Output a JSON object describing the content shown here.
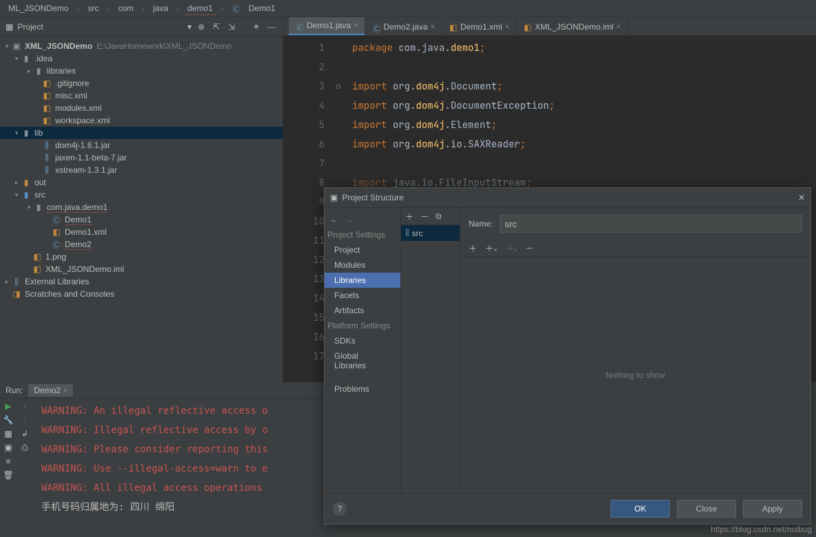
{
  "breadcrumb": {
    "root": "ML_JSONDemo",
    "parts": [
      "src",
      "com",
      "java",
      "demo1",
      "Demo1"
    ]
  },
  "project": {
    "header": "Project",
    "root": "XML_JSONDemo",
    "rootPath": "E:\\JavaHomework\\XML_JSONDemo",
    "idea": ".idea",
    "libraries": "libraries",
    "gitignore": ".gitignore",
    "miscxml": "misc.xml",
    "modulesxml": "modules.xml",
    "workspacexml": "workspace.xml",
    "lib": "lib",
    "dom4j": "dom4j-1.6.1.jar",
    "jaxen": "jaxen-1.1-beta-7.jar",
    "xstream": "xstream-1.3.1.jar",
    "out": "out",
    "src": "src",
    "pkg": "com.java.demo1",
    "demo1": "Demo1",
    "demo1xml": "Demo1.xml",
    "demo2": "Demo2",
    "png": "1.png",
    "iml": "XML_JSONDemo.iml",
    "extlib": "External Libraries",
    "scratch": "Scratches and Consoles"
  },
  "tabs": [
    {
      "label": "Demo1.java",
      "active": true
    },
    {
      "label": "Demo2.java",
      "active": false
    },
    {
      "label": "Demo1.xml",
      "active": false
    },
    {
      "label": "XML_JSONDemo.iml",
      "active": false
    }
  ],
  "code": {
    "lines": [
      "package com.java.demo1;",
      "",
      "import org.dom4j.Document;",
      "import org.dom4j.DocumentException;",
      "import org.dom4j.Element;",
      "import org.dom4j.io.SAXReader;",
      "",
      "import java.io.FileInputStream;",
      "",
      "",
      "",
      "",
      "",
      "",
      "",
      "",
      ""
    ]
  },
  "run": {
    "title": "Run:",
    "tab": "Demo2",
    "lines": [
      "WARNING: An illegal reflective access o",
      "WARNING: Illegal reflective access by o",
      "WARNING: Please consider reporting this",
      "WARNING: Use --illegal-access=warn to e",
      "WARNING: All illegal access operations "
    ],
    "lastline": "手机号码归属地为: 四川 绵阳"
  },
  "dialog": {
    "title": "Project Structure",
    "nav": {
      "projectSettings": "Project Settings",
      "project": "Project",
      "modules": "Modules",
      "libraries": "Libraries",
      "facets": "Facets",
      "artifacts": "Artifacts",
      "platformSettings": "Platform Settings",
      "sdks": "SDKs",
      "globalLibraries": "Global Libraries",
      "problems": "Problems"
    },
    "midItem": "src",
    "nameLabel": "Name:",
    "nameValue": "src",
    "empty": "Nothing to show",
    "ok": "OK",
    "close": "Close",
    "apply": "Apply"
  },
  "watermark": "https://blog.csdn.net/noibug"
}
